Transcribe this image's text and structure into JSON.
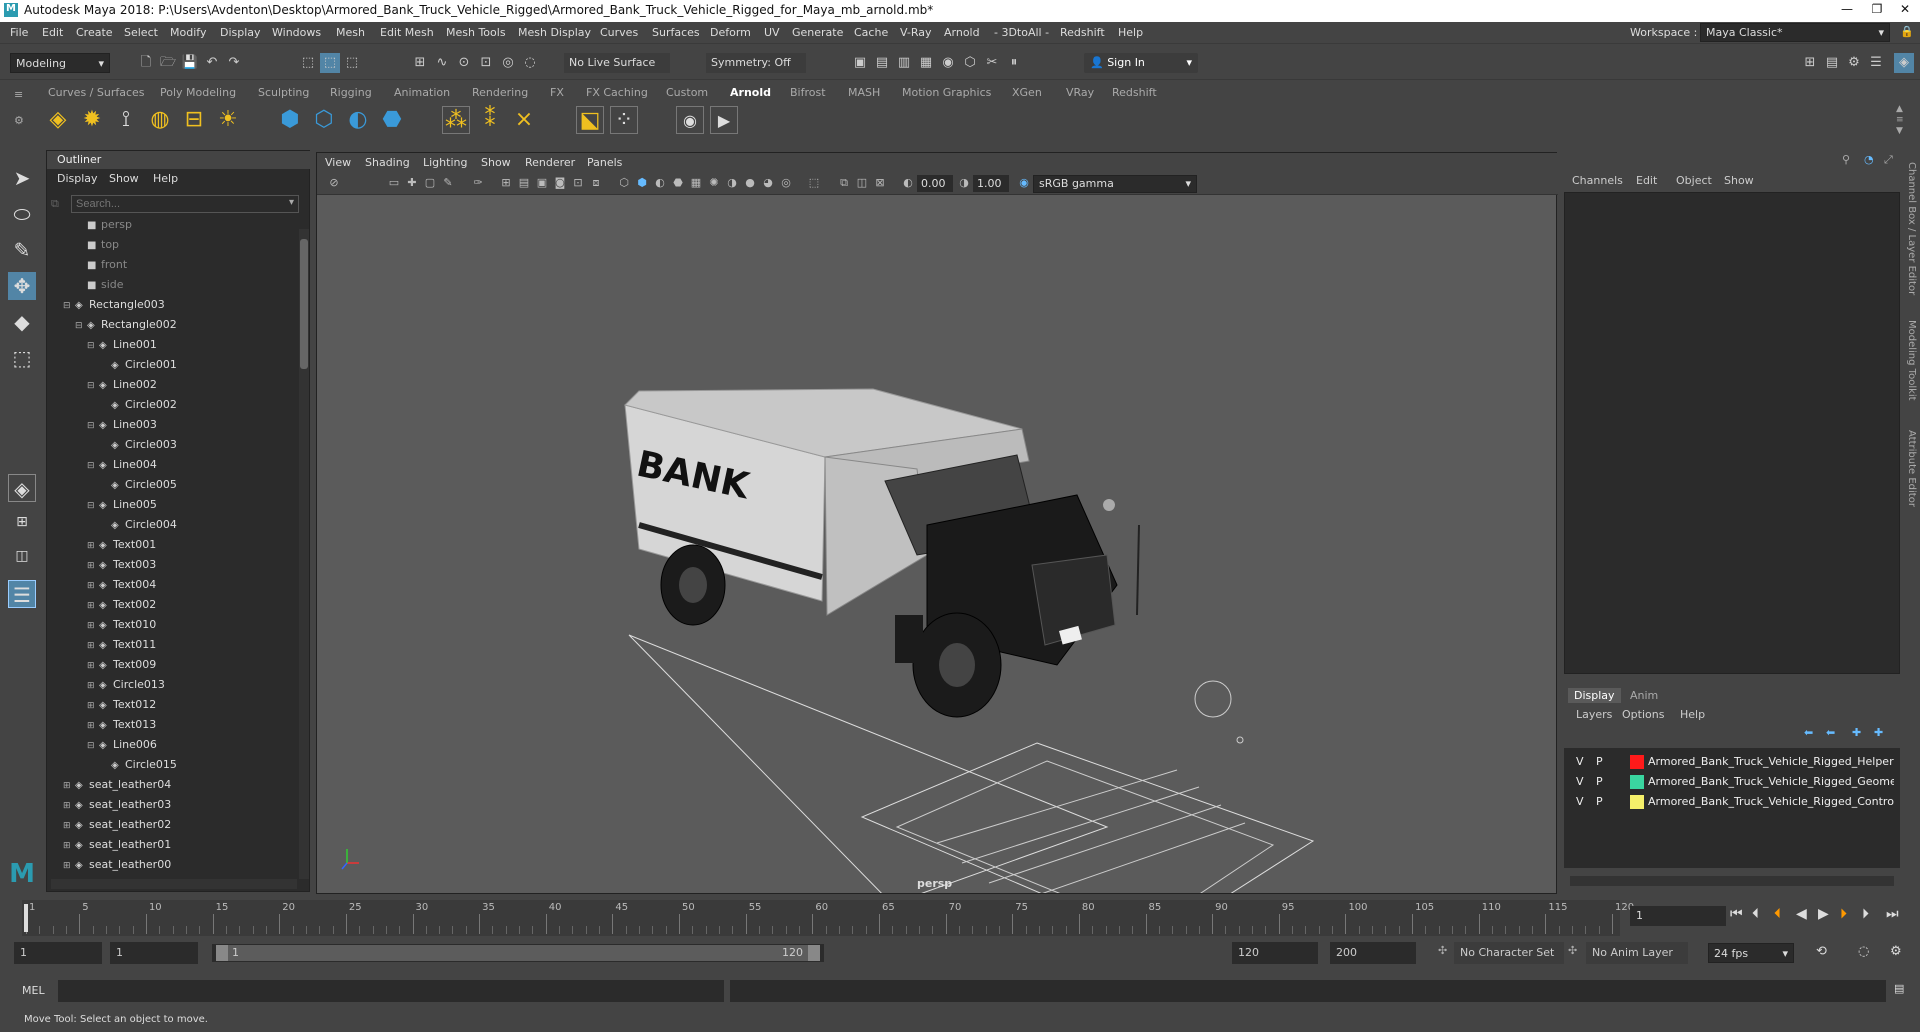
{
  "window": {
    "title": "Autodesk Maya 2018: P:\\Users\\Avdenton\\Desktop\\Armored_Bank_Truck_Vehicle_Rigged\\Armored_Bank_Truck_Vehicle_Rigged_for_Maya_mb_arnold.mb*",
    "logo": "M",
    "buttons": [
      "—",
      "❐",
      "✕"
    ]
  },
  "menus": [
    "File",
    "Edit",
    "Create",
    "Select",
    "Modify",
    "Display",
    "Windows",
    "Mesh",
    "Edit Mesh",
    "Mesh Tools",
    "Mesh Display",
    "Curves",
    "Surfaces",
    "Deform",
    "UV",
    "Generate",
    "Cache",
    "V-Ray",
    "Arnold",
    "- 3DtoAll -",
    "Redshift",
    "Help"
  ],
  "workspace": {
    "label": "Workspace :",
    "value": "Maya Classic*"
  },
  "statusline": {
    "mode": "Modeling",
    "live_surface": "No Live Surface",
    "symmetry": "Symmetry: Off",
    "sign_in": "Sign In"
  },
  "shelf_tabs": [
    "Curves / Surfaces",
    "Poly Modeling",
    "Sculpting",
    "Rigging",
    "Animation",
    "Rendering",
    "FX",
    "FX Caching",
    "Custom",
    "Arnold",
    "Bifrost",
    "MASH",
    "Motion Graphics",
    "XGen",
    "VRay",
    "Redshift"
  ],
  "active_shelf_tab": "Arnold",
  "outliner": {
    "title": "Outliner",
    "menus": [
      "Display",
      "Show",
      "Help"
    ],
    "search_placeholder": "Search...",
    "items": [
      {
        "label": "persp",
        "indent": 2,
        "icon": "camera",
        "dim": true,
        "toggle": ""
      },
      {
        "label": "top",
        "indent": 2,
        "icon": "camera",
        "dim": true,
        "toggle": ""
      },
      {
        "label": "front",
        "indent": 2,
        "icon": "camera",
        "dim": true,
        "toggle": ""
      },
      {
        "label": "side",
        "indent": 2,
        "icon": "camera",
        "dim": true,
        "toggle": ""
      },
      {
        "label": "Rectangle003",
        "indent": 1,
        "icon": "transform",
        "dim": false,
        "toggle": "−"
      },
      {
        "label": "Rectangle002",
        "indent": 2,
        "icon": "transform",
        "dim": false,
        "toggle": "−"
      },
      {
        "label": "Line001",
        "indent": 3,
        "icon": "transform",
        "dim": false,
        "toggle": "−"
      },
      {
        "label": "Circle001",
        "indent": 4,
        "icon": "transform",
        "dim": false,
        "toggle": ""
      },
      {
        "label": "Line002",
        "indent": 3,
        "icon": "transform",
        "dim": false,
        "toggle": "−"
      },
      {
        "label": "Circle002",
        "indent": 4,
        "icon": "transform",
        "dim": false,
        "toggle": ""
      },
      {
        "label": "Line003",
        "indent": 3,
        "icon": "transform",
        "dim": false,
        "toggle": "−"
      },
      {
        "label": "Circle003",
        "indent": 4,
        "icon": "transform",
        "dim": false,
        "toggle": ""
      },
      {
        "label": "Line004",
        "indent": 3,
        "icon": "transform",
        "dim": false,
        "toggle": "−"
      },
      {
        "label": "Circle005",
        "indent": 4,
        "icon": "transform",
        "dim": false,
        "toggle": ""
      },
      {
        "label": "Line005",
        "indent": 3,
        "icon": "transform",
        "dim": false,
        "toggle": "−"
      },
      {
        "label": "Circle004",
        "indent": 4,
        "icon": "transform",
        "dim": false,
        "toggle": ""
      },
      {
        "label": "Text001",
        "indent": 3,
        "icon": "transform",
        "dim": false,
        "toggle": "+"
      },
      {
        "label": "Text003",
        "indent": 3,
        "icon": "transform",
        "dim": false,
        "toggle": "+"
      },
      {
        "label": "Text004",
        "indent": 3,
        "icon": "transform",
        "dim": false,
        "toggle": "+"
      },
      {
        "label": "Text002",
        "indent": 3,
        "icon": "transform",
        "dim": false,
        "toggle": "+"
      },
      {
        "label": "Text010",
        "indent": 3,
        "icon": "transform",
        "dim": false,
        "toggle": "+"
      },
      {
        "label": "Text011",
        "indent": 3,
        "icon": "transform",
        "dim": false,
        "toggle": "+"
      },
      {
        "label": "Text009",
        "indent": 3,
        "icon": "transform",
        "dim": false,
        "toggle": "+"
      },
      {
        "label": "Circle013",
        "indent": 3,
        "icon": "transform",
        "dim": false,
        "toggle": "+"
      },
      {
        "label": "Text012",
        "indent": 3,
        "icon": "transform",
        "dim": false,
        "toggle": "+"
      },
      {
        "label": "Text013",
        "indent": 3,
        "icon": "transform",
        "dim": false,
        "toggle": "+"
      },
      {
        "label": "Line006",
        "indent": 3,
        "icon": "transform",
        "dim": false,
        "toggle": "−"
      },
      {
        "label": "Circle015",
        "indent": 4,
        "icon": "transform",
        "dim": false,
        "toggle": ""
      },
      {
        "label": "seat_leather04",
        "indent": 1,
        "icon": "transform",
        "dim": false,
        "toggle": "+"
      },
      {
        "label": "seat_leather03",
        "indent": 1,
        "icon": "transform",
        "dim": false,
        "toggle": "+"
      },
      {
        "label": "seat_leather02",
        "indent": 1,
        "icon": "transform",
        "dim": false,
        "toggle": "+"
      },
      {
        "label": "seat_leather01",
        "indent": 1,
        "icon": "transform",
        "dim": false,
        "toggle": "+"
      },
      {
        "label": "seat_leather00",
        "indent": 1,
        "icon": "transform",
        "dim": false,
        "toggle": "+"
      }
    ]
  },
  "viewport": {
    "menus": [
      "View",
      "Shading",
      "Lighting",
      "Show",
      "Renderer",
      "Panels"
    ],
    "exposure": "0.00",
    "gamma": "1.00",
    "color_space": "sRGB gamma",
    "camera_label": "persp",
    "truck_text": "BANK"
  },
  "channelbox": {
    "menus": [
      "Channels",
      "Edit",
      "Object",
      "Show"
    ]
  },
  "layer_editor": {
    "tabs": [
      "Display",
      "Anim"
    ],
    "menus": [
      "Layers",
      "Options",
      "Help"
    ],
    "layers": [
      {
        "v": "V",
        "p": "P",
        "color": "#ff1a1a",
        "name": "Armored_Bank_Truck_Vehicle_Rigged_Helpers"
      },
      {
        "v": "V",
        "p": "P",
        "color": "#3ad6a0",
        "name": "Armored_Bank_Truck_Vehicle_Rigged_Geometry"
      },
      {
        "v": "V",
        "p": "P",
        "color": "#f5f06a",
        "name": "Armored_Bank_Truck_Vehicle_Rigged_Controllers"
      }
    ]
  },
  "side_tabs": [
    "Channel Box / Layer Editor",
    "Modeling Toolkit",
    "Attribute Editor"
  ],
  "timeline": {
    "ticks": [
      "1",
      "5",
      "10",
      "15",
      "20",
      "25",
      "30",
      "35",
      "40",
      "45",
      "50",
      "55",
      "60",
      "65",
      "70",
      "75",
      "80",
      "85",
      "90",
      "95",
      "100",
      "105",
      "110",
      "115",
      "120"
    ],
    "current_frame": "1"
  },
  "range": {
    "start": "1",
    "playback_start": "1",
    "slider_start": "1",
    "slider_end": "120",
    "playback_end": "120",
    "end": "200",
    "character_set": "No Character Set",
    "anim_layer": "No Anim Layer",
    "fps": "24 fps"
  },
  "cmdline": {
    "label": "MEL"
  },
  "helpline": {
    "text": "Move Tool: Select an object to move."
  }
}
